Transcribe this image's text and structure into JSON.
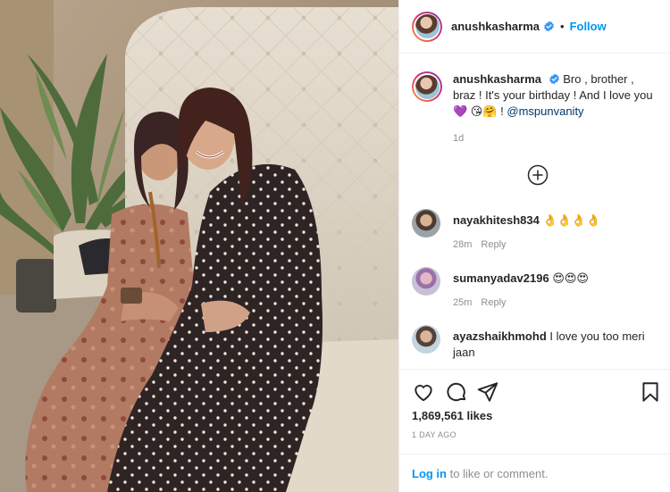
{
  "post": {
    "author": "anushkasharma",
    "follow_label": "Follow",
    "separator": "•"
  },
  "caption": {
    "username": "anushkasharma",
    "text": "Bro , brother , braz ! It's your birthday ! And I love you 💜 😘🤗 ! ",
    "mention": "@mspunvanity",
    "time": "1d"
  },
  "comments": [
    {
      "username": "nayakhitesh834",
      "text": "👌👌👌👌",
      "time": "28m",
      "reply_label": "Reply"
    },
    {
      "username": "sumanyadav2196",
      "text": "😍😍😍",
      "time": "25m",
      "reply_label": "Reply"
    },
    {
      "username": "ayazshaikhmohd",
      "text": "I love you too meri jaan"
    }
  ],
  "actions": {
    "likes": "1,869,561 likes",
    "posted": "1 DAY AGO"
  },
  "login": {
    "link_label": "Log in",
    "suffix": " to like or comment."
  },
  "icons": {
    "verified": "verified-badge-icon",
    "load_more": "plus-circle-icon",
    "like": "heart-outline-icon",
    "comment": "speech-bubble-icon",
    "share": "paper-plane-icon",
    "save": "bookmark-icon"
  },
  "colors": {
    "accent": "#0095f6",
    "mention": "#00376b",
    "muted": "#8e8e8e",
    "border": "#efefef"
  }
}
